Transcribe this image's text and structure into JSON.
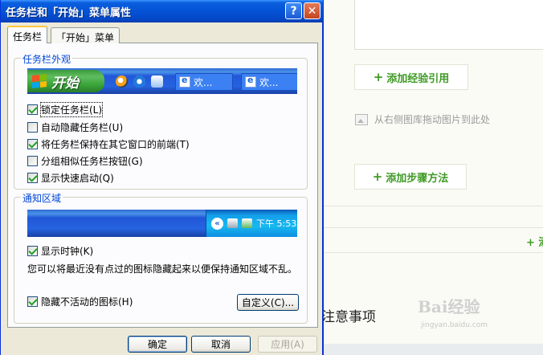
{
  "background": {
    "add_reference_label": "添加经验引用",
    "image_hint": "从右侧图库拖动图片到此处",
    "add_step_label": "添加步骤方法",
    "right_plus": "+ 添",
    "notes_title": "注意事项",
    "watermark": "Bai经验",
    "watermark_url": "jingyan.baidu.com",
    "plus": "+"
  },
  "dialog": {
    "title": "任务栏和「开始」菜单属性",
    "help_button": "?",
    "close_button": "✕",
    "tabs": [
      "任务栏",
      "「开始」菜单"
    ],
    "taskbar_group": {
      "title": "任务栏外观",
      "start_label": "开始",
      "task_buttons": [
        "欢...",
        "欢..."
      ],
      "checkboxes": [
        {
          "label": "锁定任务栏(L)",
          "checked": true
        },
        {
          "label": "自动隐藏任务栏(U)",
          "checked": false
        },
        {
          "label": "将任务栏保持在其它窗口的前端(T)",
          "checked": true
        },
        {
          "label": "分组相似任务栏按钮(G)",
          "checked": false
        },
        {
          "label": "显示快速启动(Q)",
          "checked": true
        }
      ]
    },
    "notify_group": {
      "title": "通知区域",
      "clock": "下午 5:53",
      "show_clock": {
        "label": "显示时钟(K)",
        "checked": true
      },
      "description": "您可以将最近没有点过的图标隐藏起来以便保持通知区域不乱。",
      "hide_inactive": {
        "label": "隐藏不活动的图标(H)",
        "checked": true
      },
      "customize_button": "自定义(C)..."
    },
    "buttons": {
      "ok": "确定",
      "cancel": "取消",
      "apply": "应用(A)"
    }
  }
}
